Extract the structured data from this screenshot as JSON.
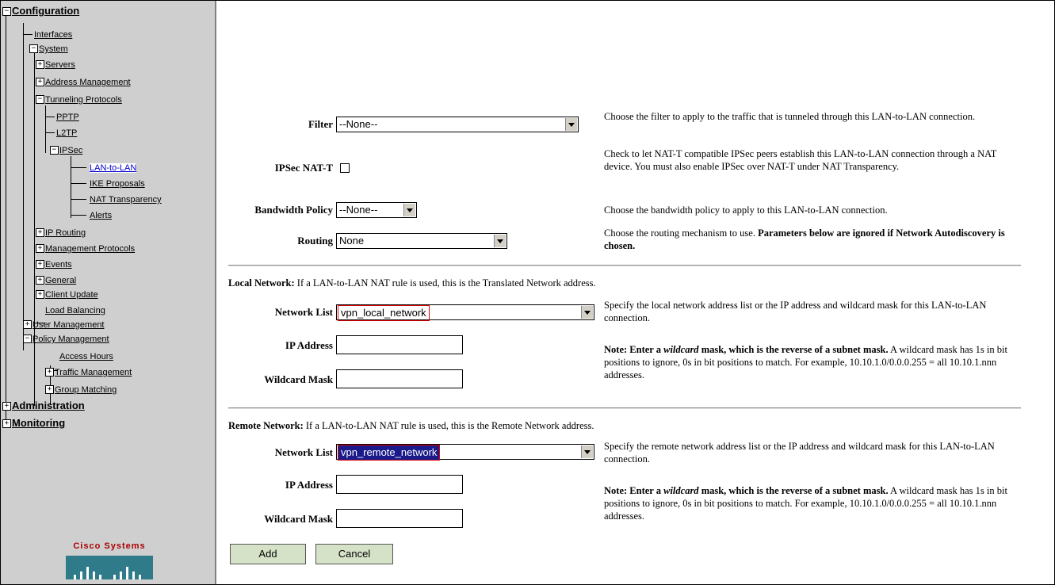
{
  "sidebar": {
    "configuration": "Configuration",
    "interfaces": "Interfaces",
    "system": "System",
    "servers": "Servers",
    "address_management": "Address Management",
    "tunneling_protocols": "Tunneling Protocols",
    "pptp": "PPTP",
    "l2tp": "L2TP",
    "ipsec": "IPSec",
    "lan_to_lan": "LAN-to-LAN",
    "ike_proposals": "IKE Proposals",
    "nat_transparency": "NAT Transparency",
    "alerts": "Alerts",
    "ip_routing": "IP Routing",
    "management_protocols": "Management Protocols",
    "events": "Events",
    "general": "General",
    "client_update": "Client Update",
    "load_balancing": "Load Balancing",
    "user_management": "User Management",
    "policy_management": "Policy Management",
    "access_hours": "Access Hours",
    "traffic_management": "Traffic Management",
    "group_matching": "Group Matching",
    "administration": "Administration",
    "monitoring": "Monitoring",
    "logo_text": "Cisco Systems"
  },
  "form": {
    "filter": {
      "label": "Filter",
      "value": "--None--",
      "help": "Choose the filter to apply to the traffic that is tunneled through this LAN-to-LAN connection."
    },
    "ipsec_nat_t": {
      "label": "IPSec NAT-T",
      "checked": false,
      "help": "Check to let NAT-T compatible IPSec peers establish this LAN-to-LAN connection through a NAT device. You must also enable IPSec over NAT-T under NAT Transparency."
    },
    "bandwidth_policy": {
      "label": "Bandwidth Policy",
      "value": "--None--",
      "help": "Choose the bandwidth policy to apply to this LAN-to-LAN connection."
    },
    "routing": {
      "label": "Routing",
      "value": "None",
      "help": "Choose the routing mechanism to use.",
      "help_bold": "Parameters below are ignored if Network Autodiscovery is chosen."
    },
    "local": {
      "title": "Local Network:",
      "title_rest": "If a LAN-to-LAN NAT rule is used, this is the Translated Network address.",
      "network_list_label": "Network List",
      "network_list_value": "vpn_local_network",
      "network_list_help": "Specify the local network address list or the IP address and wildcard mask for this LAN-to-LAN connection.",
      "ip_label": "IP Address",
      "ip_value": "",
      "wildcard_label": "Wildcard Mask",
      "wildcard_value": "",
      "note_bold_1": "Note: Enter a",
      "note_italic": "wildcard",
      "note_bold_2": "mask, which is the reverse of a subnet mask.",
      "note_rest": "A wildcard mask has 1s in bit positions to ignore, 0s in bit positions to match. For example, 10.10.1.0/0.0.0.255 = all 10.10.1.nnn addresses."
    },
    "remote": {
      "title": "Remote Network:",
      "title_rest": "If a LAN-to-LAN NAT rule is used, this is the Remote Network address.",
      "network_list_label": "Network List",
      "network_list_value": "vpn_remote_network",
      "network_list_help": "Specify the remote network address list or the IP address and wildcard mask for this LAN-to-LAN connection.",
      "ip_label": "IP Address",
      "ip_value": "",
      "wildcard_label": "Wildcard Mask",
      "wildcard_value": "",
      "note_bold_1": "Note: Enter a",
      "note_italic": "wildcard",
      "note_bold_2": "mask, which is the reverse of a subnet mask.",
      "note_rest": "A wildcard mask has 1s in bit positions to ignore, 0s in bit positions to match. For example, 10.10.1.0/0.0.0.255 = all 10.10.1.nnn addresses."
    },
    "add_label": "Add",
    "cancel_label": "Cancel"
  }
}
